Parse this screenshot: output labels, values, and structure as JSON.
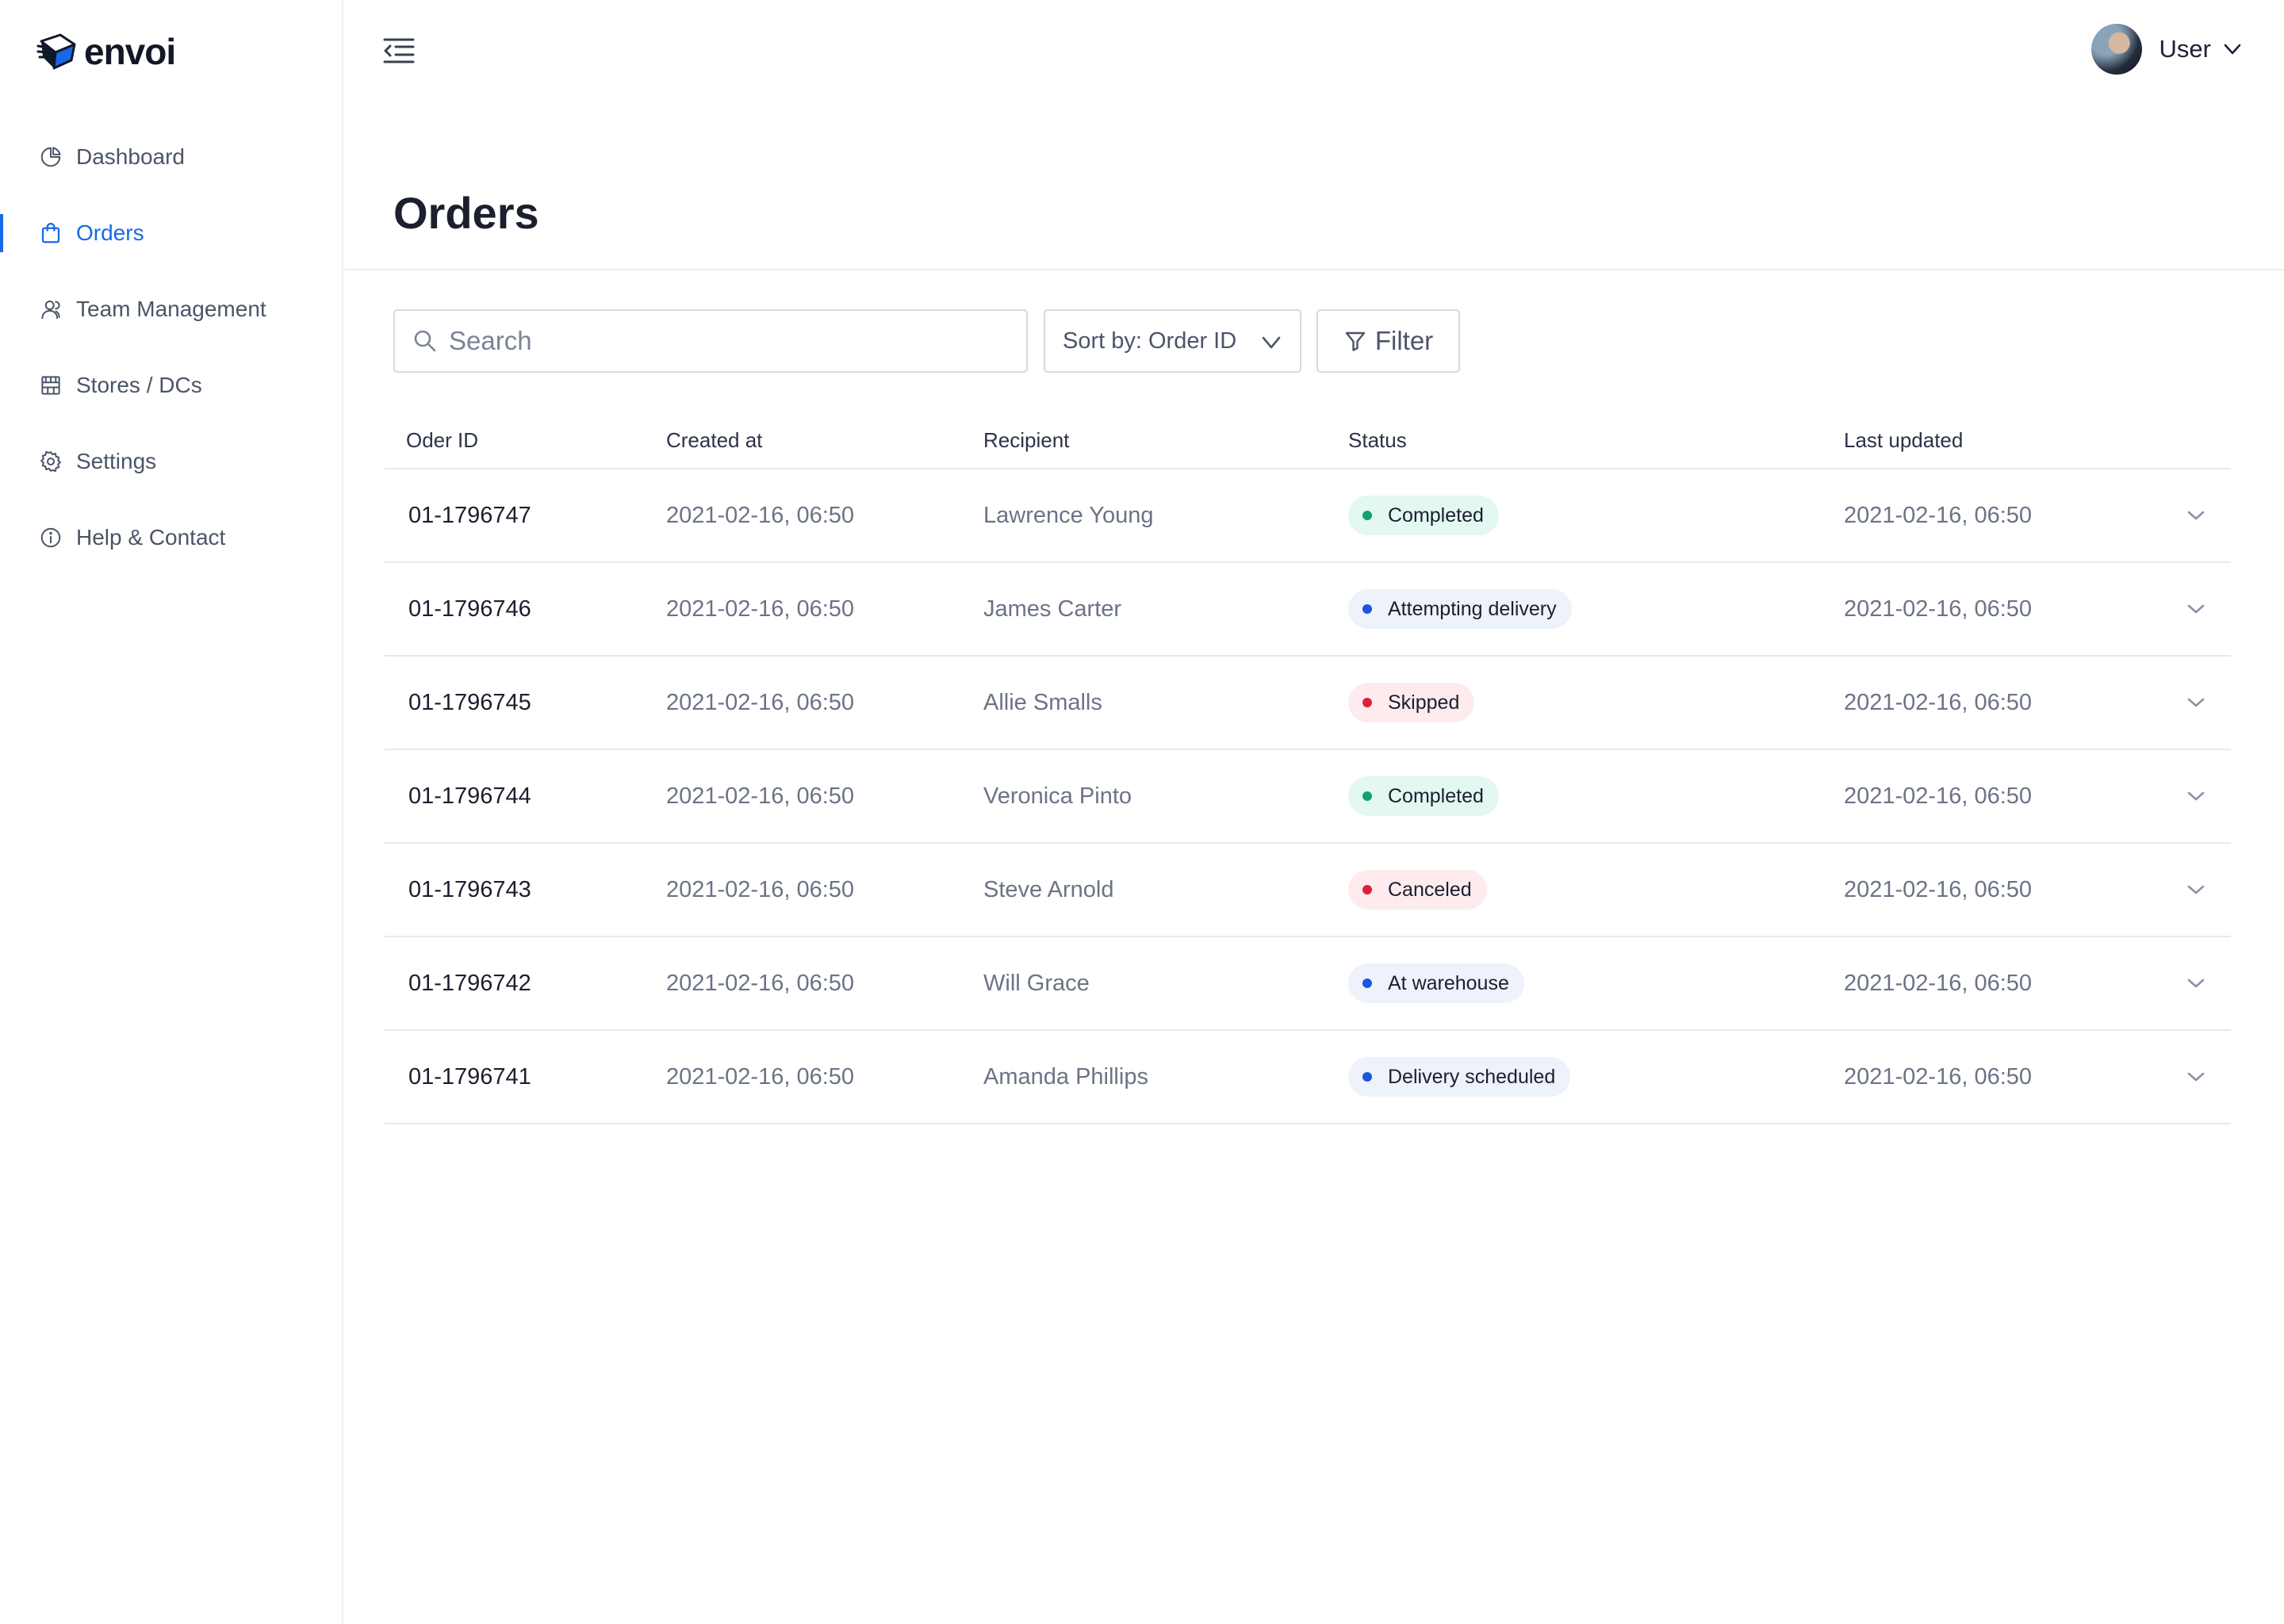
{
  "brand": {
    "name": "envoi"
  },
  "sidebar": {
    "items": [
      {
        "label": "Dashboard",
        "icon": "pie-chart-icon",
        "active": false
      },
      {
        "label": "Orders",
        "icon": "shopping-bag-icon",
        "active": true
      },
      {
        "label": "Team Management",
        "icon": "users-icon",
        "active": false
      },
      {
        "label": "Stores / DCs",
        "icon": "store-icon",
        "active": false
      },
      {
        "label": "Settings",
        "icon": "gear-icon",
        "active": false
      },
      {
        "label": "Help & Contact",
        "icon": "info-icon",
        "active": false
      }
    ]
  },
  "topbar": {
    "user_label": "User"
  },
  "page": {
    "title": "Orders"
  },
  "toolbar": {
    "search_placeholder": "Search",
    "sort_label": "Sort by: Order ID",
    "filter_label": "Filter"
  },
  "table": {
    "columns": [
      "Oder ID",
      "Created at",
      "Recipient",
      "Status",
      "Last updated"
    ],
    "rows": [
      {
        "id": "01-1796747",
        "created": "2021-02-16, 06:50",
        "recipient": "Lawrence Young",
        "status": "Completed",
        "status_tone": "green",
        "updated": "2021-02-16, 06:50"
      },
      {
        "id": "01-1796746",
        "created": "2021-02-16, 06:50",
        "recipient": "James Carter",
        "status": "Attempting delivery",
        "status_tone": "blue",
        "updated": "2021-02-16, 06:50"
      },
      {
        "id": "01-1796745",
        "created": "2021-02-16, 06:50",
        "recipient": "Allie Smalls",
        "status": "Skipped",
        "status_tone": "red",
        "updated": "2021-02-16, 06:50"
      },
      {
        "id": "01-1796744",
        "created": "2021-02-16, 06:50",
        "recipient": "Veronica Pinto",
        "status": "Completed",
        "status_tone": "green",
        "updated": "2021-02-16, 06:50"
      },
      {
        "id": "01-1796743",
        "created": "2021-02-16, 06:50",
        "recipient": "Steve Arnold",
        "status": "Canceled",
        "status_tone": "red",
        "updated": "2021-02-16, 06:50"
      },
      {
        "id": "01-1796742",
        "created": "2021-02-16, 06:50",
        "recipient": "Will Grace",
        "status": "At warehouse",
        "status_tone": "blue",
        "updated": "2021-02-16, 06:50"
      },
      {
        "id": "01-1796741",
        "created": "2021-02-16, 06:50",
        "recipient": "Amanda Phillips",
        "status": "Delivery scheduled",
        "status_tone": "blue",
        "updated": "2021-02-16, 06:50"
      }
    ]
  },
  "colors": {
    "accent": "#1769e8",
    "status_green": "#10a36b",
    "status_blue": "#1d55e0",
    "status_red": "#e11d3c"
  }
}
